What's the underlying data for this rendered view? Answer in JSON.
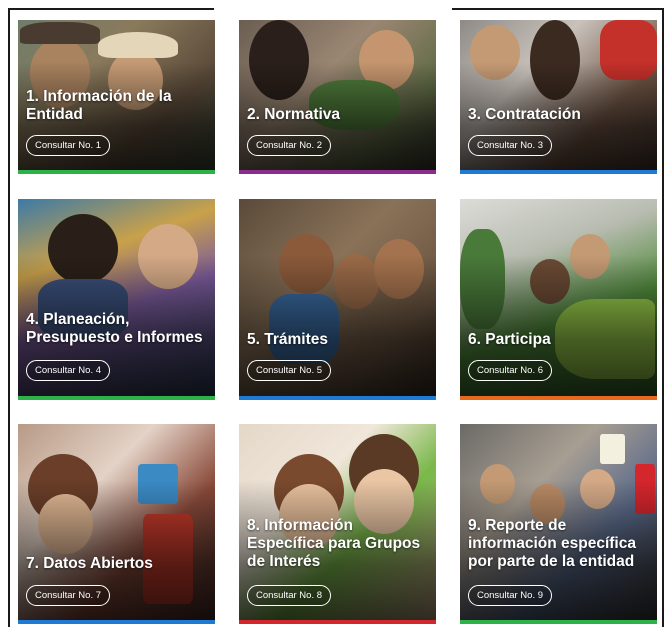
{
  "cards": [
    {
      "title": "1. Información de la Entidad",
      "button": "Consultar No. 1",
      "bar_color": "#2db24a"
    },
    {
      "title": "2. Normativa",
      "button": "Consultar No. 2",
      "bar_color": "#8a2d8f"
    },
    {
      "title": "3. Contratación",
      "button": "Consultar No. 3",
      "bar_color": "#1f7ad4"
    },
    {
      "title": "4. Planeación, Presupuesto e Informes",
      "button": "Consultar No. 4",
      "bar_color": "#2db24a"
    },
    {
      "title": "5. Trámites",
      "button": "Consultar No. 5",
      "bar_color": "#1f7ad4"
    },
    {
      "title": "6. Participa",
      "button": "Consultar No. 6",
      "bar_color": "#e8691e"
    },
    {
      "title": "7. Datos Abiertos",
      "button": "Consultar No. 7",
      "bar_color": "#1f7ad4"
    },
    {
      "title": "8. Información Específica para Grupos de Interés",
      "button": "Consultar No. 8",
      "bar_color": "#d4262d"
    },
    {
      "title": "9. Reporte de información específica por parte de la entidad",
      "button": "Consultar No. 9",
      "bar_color": "#2db24a"
    }
  ]
}
